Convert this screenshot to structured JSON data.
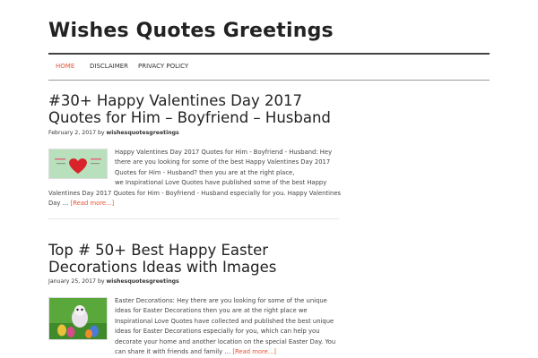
{
  "site": {
    "title": "Wishes Quotes Greetings"
  },
  "nav": {
    "items": [
      "HOME",
      "DISCLAIMER",
      "PRIVACY POLICY"
    ]
  },
  "posts": [
    {
      "title_line1": "#30+ Happy Valentines Day 2017",
      "title_line2": "Quotes for Him – Boyfriend – Husband",
      "date": "February 2, 2017",
      "by": "by",
      "author": "wishesquotesgreetings",
      "excerpt_lines": [
        "Happy Valentines Day 2017 Quotes for Him - Boyfriend - Husband: Hey",
        "there are you looking for some of the best Happy Valentines Day 2017",
        "Quotes for Him - Husband? then you are at the right place,",
        "we Inspirational Love Quotes have published some of the best Happy",
        "Valentines Day 2017 Quotes for Him - Boyfriend - Husband especially for you. Happy Valentines",
        "Day …"
      ],
      "read_more": "[Read more...]"
    },
    {
      "title_line1": "Top # 50+ Best Happy Easter",
      "title_line2": "Decorations Ideas with Images",
      "date": "January 25, 2017",
      "by": "by",
      "author": "wishesquotesgreetings",
      "excerpt_lines": [
        "Easter Decorations: Hey there are you looking for some of the unique",
        "ideas for Easter Decorations then you are at the right place we",
        "Inspirational Love Quotes have collected and published the best unique",
        "ideas for Easter Decorations especially for you, which can help you",
        "decorate your home and another location on the special Easter Day. You",
        "can share it with friends and family …"
      ],
      "read_more": "[Read more...]"
    }
  ]
}
